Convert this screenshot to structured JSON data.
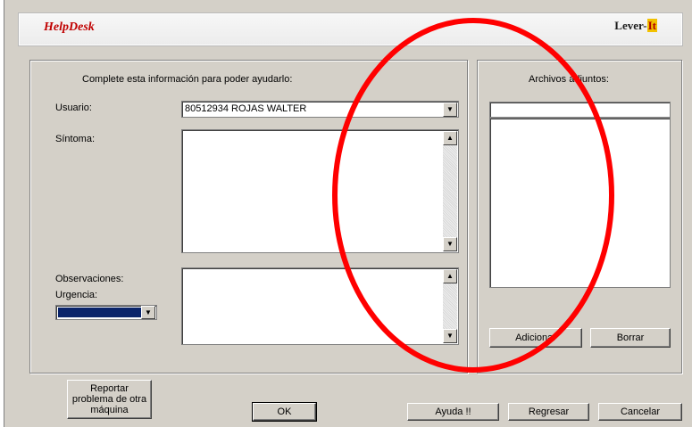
{
  "header": {
    "app_title": "HelpDesk",
    "brand_prefix": "Lever-",
    "brand_suffix": "It"
  },
  "form": {
    "instructions": "Complete esta información para poder ayudarlo:",
    "user_label": "Usuario:",
    "user_value": "80512934 ROJAS WALTER",
    "symptom_label": "Síntoma:",
    "symptom_value": "",
    "observations_label": "Observaciones:",
    "observations_value": "",
    "urgency_label": "Urgencia:",
    "urgency_value": ""
  },
  "attachments": {
    "title": "Archivos adjuntos:",
    "add_label": "Adicionar",
    "delete_label": "Borrar"
  },
  "footer": {
    "report_label": "Reportar problema de otra máquina",
    "ok_label": "OK",
    "help_label": "Ayuda !!",
    "back_label": "Regresar",
    "cancel_label": "Cancelar"
  },
  "colors": {
    "annotation_red": "#ff0000",
    "urgency_fill": "#0a246a",
    "title_red": "#c00000"
  },
  "icons": {
    "combo_arrow": "chevron-down-icon",
    "scroll_up": "arrow-up-icon",
    "scroll_down": "arrow-down-icon"
  }
}
